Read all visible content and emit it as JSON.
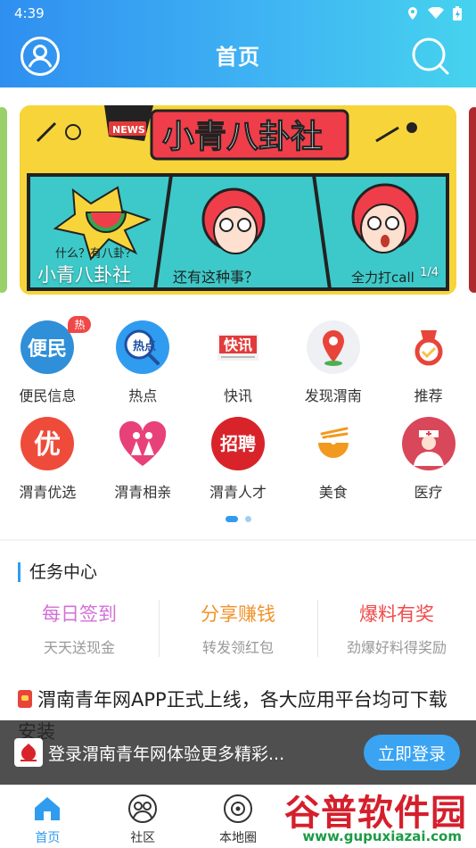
{
  "status_bar": {
    "time": "4:39"
  },
  "header": {
    "title": "首页"
  },
  "banner": {
    "caption": "小青八卦社",
    "counter": "1/4",
    "art_title": "小青八卦社",
    "art_tag": "NEWS",
    "art_texts": [
      "什么？有八卦？",
      "还有这种事？",
      "全力打call"
    ]
  },
  "grid": {
    "items": [
      {
        "label": "便民信息",
        "icon": "bianmin-icon",
        "badge": "热",
        "glyph": "便民"
      },
      {
        "label": "热点",
        "icon": "hotspot-icon",
        "glyph": "热点"
      },
      {
        "label": "快讯",
        "icon": "newsflash-icon",
        "glyph": "快讯"
      },
      {
        "label": "发现渭南",
        "icon": "location-pin-icon"
      },
      {
        "label": "推荐",
        "icon": "recommend-icon"
      },
      {
        "label": "渭青优选",
        "icon": "youxuan-icon",
        "glyph": "优"
      },
      {
        "label": "渭青相亲",
        "icon": "couple-heart-icon"
      },
      {
        "label": "渭青人才",
        "icon": "recruit-icon",
        "glyph": "招聘"
      },
      {
        "label": "美食",
        "icon": "noodle-bowl-icon"
      },
      {
        "label": "医疗",
        "icon": "doctor-icon"
      }
    ]
  },
  "tasks": {
    "title": "任务中心",
    "items": [
      {
        "title": "每日签到",
        "subtitle": "天天送现金",
        "color": "#d46fd8"
      },
      {
        "title": "分享赚钱",
        "subtitle": "转发领红包",
        "color": "#f0932b"
      },
      {
        "title": "爆料有奖",
        "subtitle": "劲爆好料得奖励",
        "color": "#f04a4a"
      }
    ]
  },
  "news": {
    "headline": "渭南青年网APP正式上线，各大应用平台均可下载安装"
  },
  "login_bar": {
    "text": "登录渭南青年网体验更多精彩...",
    "button": "立即登录"
  },
  "tabbar": {
    "items": [
      {
        "label": "首页",
        "icon": "home-icon",
        "active": true
      },
      {
        "label": "社区",
        "icon": "community-icon"
      },
      {
        "label": "本地圈",
        "icon": "local-circle-icon"
      },
      {
        "label": "",
        "icon": ""
      },
      {
        "label": "",
        "icon": ""
      }
    ]
  },
  "watermark": {
    "name": "谷普软件园",
    "url": "www.gupuxiazai.com"
  },
  "colors": {
    "primary": "#2f9cf0",
    "header_start": "#2f8ff0",
    "header_end": "#46d3ee",
    "banner_bg": "#f7d43a"
  }
}
